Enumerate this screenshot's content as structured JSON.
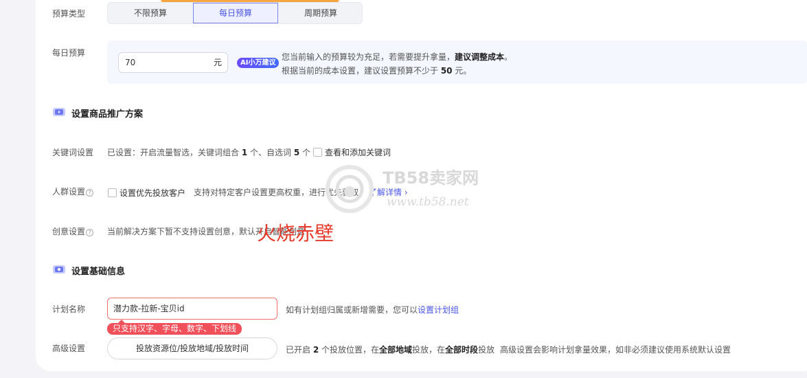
{
  "budget_type": {
    "label": "预算类型",
    "options": [
      "不限预算",
      "每日预算",
      "周期预算"
    ],
    "selected": "每日预算"
  },
  "daily_budget": {
    "label": "每日预算",
    "value": "70",
    "unit": "元",
    "ai_badge": "AI小万建议",
    "hint_line1_prefix": "您当前输入的预算较为充足，若需要提升拿量，",
    "hint_line1_bold": "建议调整成本",
    "hint_line1_suffix": "。",
    "hint_line2_prefix": "根据当前的成本设置，建议设置预算不少于 ",
    "hint_line2_bold": "50",
    "hint_line2_suffix": " 元。"
  },
  "section_promo": {
    "title": "设置商品推广方案"
  },
  "keywords": {
    "label": "关键词设置",
    "text_prefix": "已设置：开启流量智选，关键词组合 ",
    "combo_count": "1",
    "text_mid": " 个、自选词 ",
    "word_count": "5",
    "text_suffix": " 个",
    "checkbox_label": "查看和添加关键词"
  },
  "audience": {
    "label": "人群设置",
    "checkbox_label": "设置优先投放客户",
    "description": "支持对特定客户设置更高权重，进行优先获取。",
    "link": "了解详情"
  },
  "creative": {
    "label": "创意设置",
    "text": "当前解决方案下暂不支持设置创意，默认开启智能创意"
  },
  "section_basic": {
    "title": "设置基础信息"
  },
  "plan_name": {
    "label": "计划名称",
    "value": "潜力款-拉新-宝贝id",
    "error": "只支持汉字、字母、数字、下划线",
    "hint_prefix": "如有计划组归属或新增需要，您可以",
    "hint_link": "设置计划组"
  },
  "advanced": {
    "label": "高级设置",
    "button": "投放资源位/投放地域/投放时间",
    "summary_prefix": "已开启 ",
    "position_count": "2",
    "summary_mid1": " 个投放位置，在",
    "region_bold": "全部地域",
    "summary_mid2": "投放，在",
    "time_bold": "全部时段",
    "summary_suffix": "投放",
    "note": "高级设置会影响计划拿量效果，如非必须建议使用系统默认设置"
  },
  "watermark": {
    "brand": "TB58卖家网",
    "url": "www.tb58.net",
    "overlay_text": "火烧赤壁"
  },
  "colors": {
    "accent": "#4a55e8",
    "error": "#f0505a",
    "badge": "#f7a540"
  }
}
